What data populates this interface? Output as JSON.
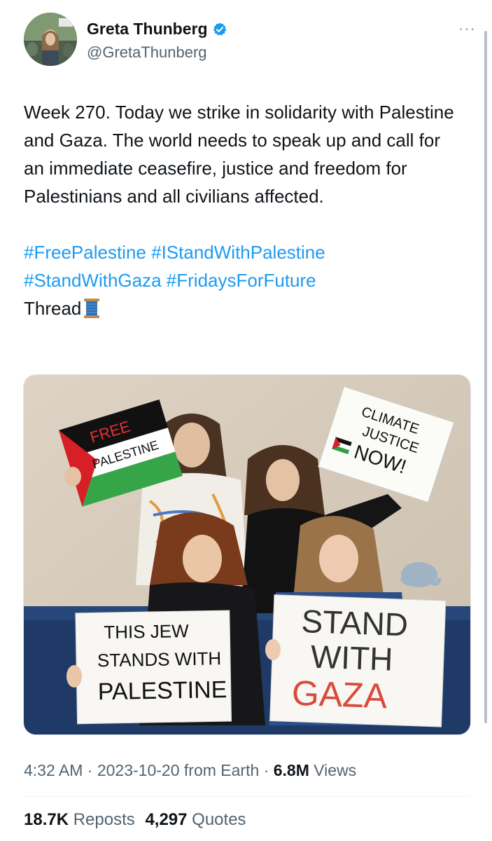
{
  "author": {
    "name": "Greta Thunberg",
    "handle": "@GretaThunberg",
    "verified_icon": "verified-badge-icon",
    "more_label": "···"
  },
  "tweet": {
    "paragraph1": "Week 270. Today we strike in solidarity with Palestine and Gaza. The world needs to speak up and call for an immediate ceasefire, justice and freedom for Palestinians and all civilians affected.",
    "hashtags_line1": [
      "#FreePalestine",
      "#IStandWithPalestine"
    ],
    "hashtags_line2": [
      "#StandWithGaza",
      "#FridaysForFuture"
    ],
    "thread_label": "Thread",
    "thread_icon": "spool-of-thread-icon"
  },
  "media": {
    "sign_free_palestine": [
      "FREE",
      "PALESTINE"
    ],
    "sign_climate": [
      "CLIMATE",
      "JUSTICE",
      "NOW!"
    ],
    "sign_jew": [
      "THIS JEW",
      "STANDS WITH",
      "PALESTINE"
    ],
    "sign_gaza": [
      "STAND",
      "WITH",
      "GAZA"
    ]
  },
  "meta": {
    "time": "4:32 AM",
    "sep1": " · ",
    "date": "2023-10-20",
    "source": " from Earth",
    "sep2": " · ",
    "views_count": "6.8M",
    "views_label": " Views"
  },
  "stats": {
    "reposts_count": "18.7K",
    "reposts_label": " Reposts",
    "quotes_count": "4,297",
    "quotes_label": " Quotes"
  },
  "colors": {
    "link": "#1d9bf0",
    "text": "#0f1419",
    "secondary": "#536471",
    "flag_red": "#d61f26",
    "flag_green": "#2f9e44"
  }
}
